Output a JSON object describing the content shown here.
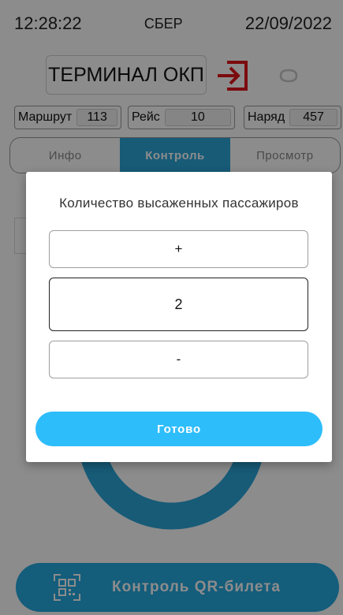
{
  "status_bar": {
    "time": "12:28:22",
    "operator": "СБЕР",
    "date": "22/09/2022"
  },
  "header": {
    "title": "ТЕРМИНАЛ ОКП",
    "exit_icon": "exit-icon",
    "sync_icon": "sync-icon"
  },
  "info": {
    "route_label": "Маршрут",
    "route_value": "113",
    "trip_label": "Рейс",
    "trip_value": "10",
    "order_label": "Наряд",
    "order_value": "457"
  },
  "tabs": [
    {
      "label": "Инфо"
    },
    {
      "label": "Контроль"
    },
    {
      "label": "Просмотр"
    }
  ],
  "qr_button": {
    "label": "Контроль QR-билета",
    "icon": "qr-scan-icon"
  },
  "dialog": {
    "title": "Количество высаженных пассажиров",
    "plus_label": "+",
    "count_value": "2",
    "minus_label": "-",
    "done_label": "Готово"
  },
  "colors": {
    "accent": "#2aa6d9",
    "done_button": "#2ebdfb",
    "exit_red": "#e0151b"
  }
}
